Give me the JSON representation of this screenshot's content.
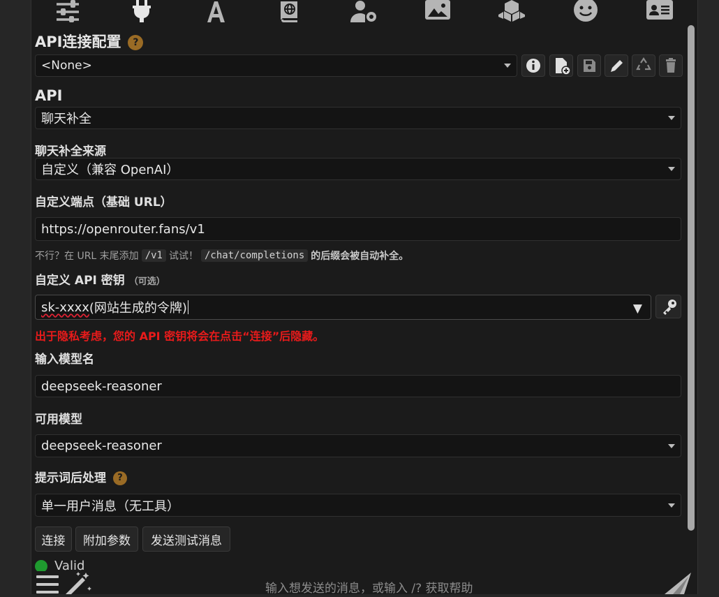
{
  "colors": {
    "accent": "#9a6b25",
    "warning": "#e81b1b",
    "valid": "#1f9a2f"
  },
  "top_icons": [
    "sliders-icon",
    "plug-icon",
    "font-icon",
    "book-atlas-icon",
    "user-gear-icon",
    "image-icon",
    "cubes-icon",
    "face-smile-icon",
    "address-card-icon"
  ],
  "profile": {
    "title": "API连接配置",
    "help": "?",
    "selected": "<None>",
    "buttons": [
      "info-icon",
      "file-add-icon",
      "save-icon",
      "pencil-icon",
      "recycle-icon",
      "trash-icon"
    ]
  },
  "api": {
    "label": "API",
    "value": "聊天补全"
  },
  "source": {
    "label": "聊天补全来源",
    "value": "自定义（兼容 OpenAI）"
  },
  "endpoint": {
    "label": "自定义端点（基础 URL）",
    "value": "https://openrouter.fans/v1",
    "hint_prefix": "不行？在 URL 末尾添加",
    "hint_code1": "/v1",
    "hint_mid": "试试！",
    "hint_code2": "/chat/completions",
    "hint_suffix": "的后缀会被自动补全。"
  },
  "apikey": {
    "label": "自定义 API 密钥",
    "optional": "（可选）",
    "value_part1": "sk-xxxx",
    "value_part2": "(网站生成的令牌)",
    "dropdown_arrow": "▼",
    "warning": "出于隐私考虑，您的 API 密钥将会在点击“连接”后隐藏。"
  },
  "model_input": {
    "label": "输入模型名",
    "value": "deepseek-reasoner"
  },
  "available_models": {
    "label": "可用模型",
    "value": "deepseek-reasoner"
  },
  "postprocess": {
    "label": "提示词后处理",
    "help": "?",
    "value": "单一用户消息（无工具）"
  },
  "actions": {
    "connect": "连接",
    "extra_params": "附加参数",
    "send_test": "发送测试消息"
  },
  "status": {
    "text": "Valid"
  },
  "chat": {
    "placeholder": "输入想发送的消息，或输入 /? 获取帮助"
  }
}
